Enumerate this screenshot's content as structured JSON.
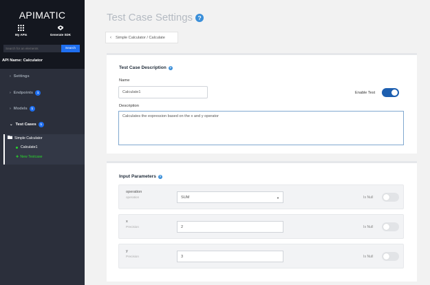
{
  "sidebar": {
    "brand": "APIMATIC",
    "links": [
      {
        "label": "My APIs",
        "icon": "grid-icon"
      },
      {
        "label": "Generate SDK",
        "icon": "sdk-icon"
      }
    ],
    "search": {
      "placeholder": "Search for an elements",
      "button": "Search"
    },
    "api_name": "API Name: Calculator",
    "nav": [
      {
        "label": "Settings",
        "badge": null
      },
      {
        "label": "Endpoints",
        "badge": "1"
      },
      {
        "label": "Models",
        "badge": "1"
      },
      {
        "label": "Test Cases",
        "badge": "1"
      }
    ],
    "sub": {
      "group": "Simple Calculator",
      "item": "Calculate1",
      "new": "New Testcase"
    }
  },
  "main": {
    "title": "Test Case Settings",
    "back": "Simple Calculator / Calculate",
    "description_card": {
      "title": "Test Case Description",
      "name_label": "Name",
      "name_value": "Calculate1",
      "enable_label": "Enable Test",
      "enable_on": true,
      "description_label": "Description",
      "description_value": "Calculates the expression based on the x and y operator"
    },
    "params_card": {
      "title": "Input Parameters",
      "is_null_label": "Is Null",
      "params": [
        {
          "name": "operation",
          "type": "operation",
          "value": "SUM",
          "dropdown": true
        },
        {
          "name": "x",
          "type": "Precision",
          "value": "2",
          "dropdown": false
        },
        {
          "name": "y",
          "type": "Precision",
          "value": "3",
          "dropdown": false
        }
      ]
    }
  },
  "colors": {
    "accent": "#1f6ff0",
    "sidebar": "#2b2f3b",
    "active_green": "#29d82c",
    "toggle_on": "#1d5fb0"
  }
}
